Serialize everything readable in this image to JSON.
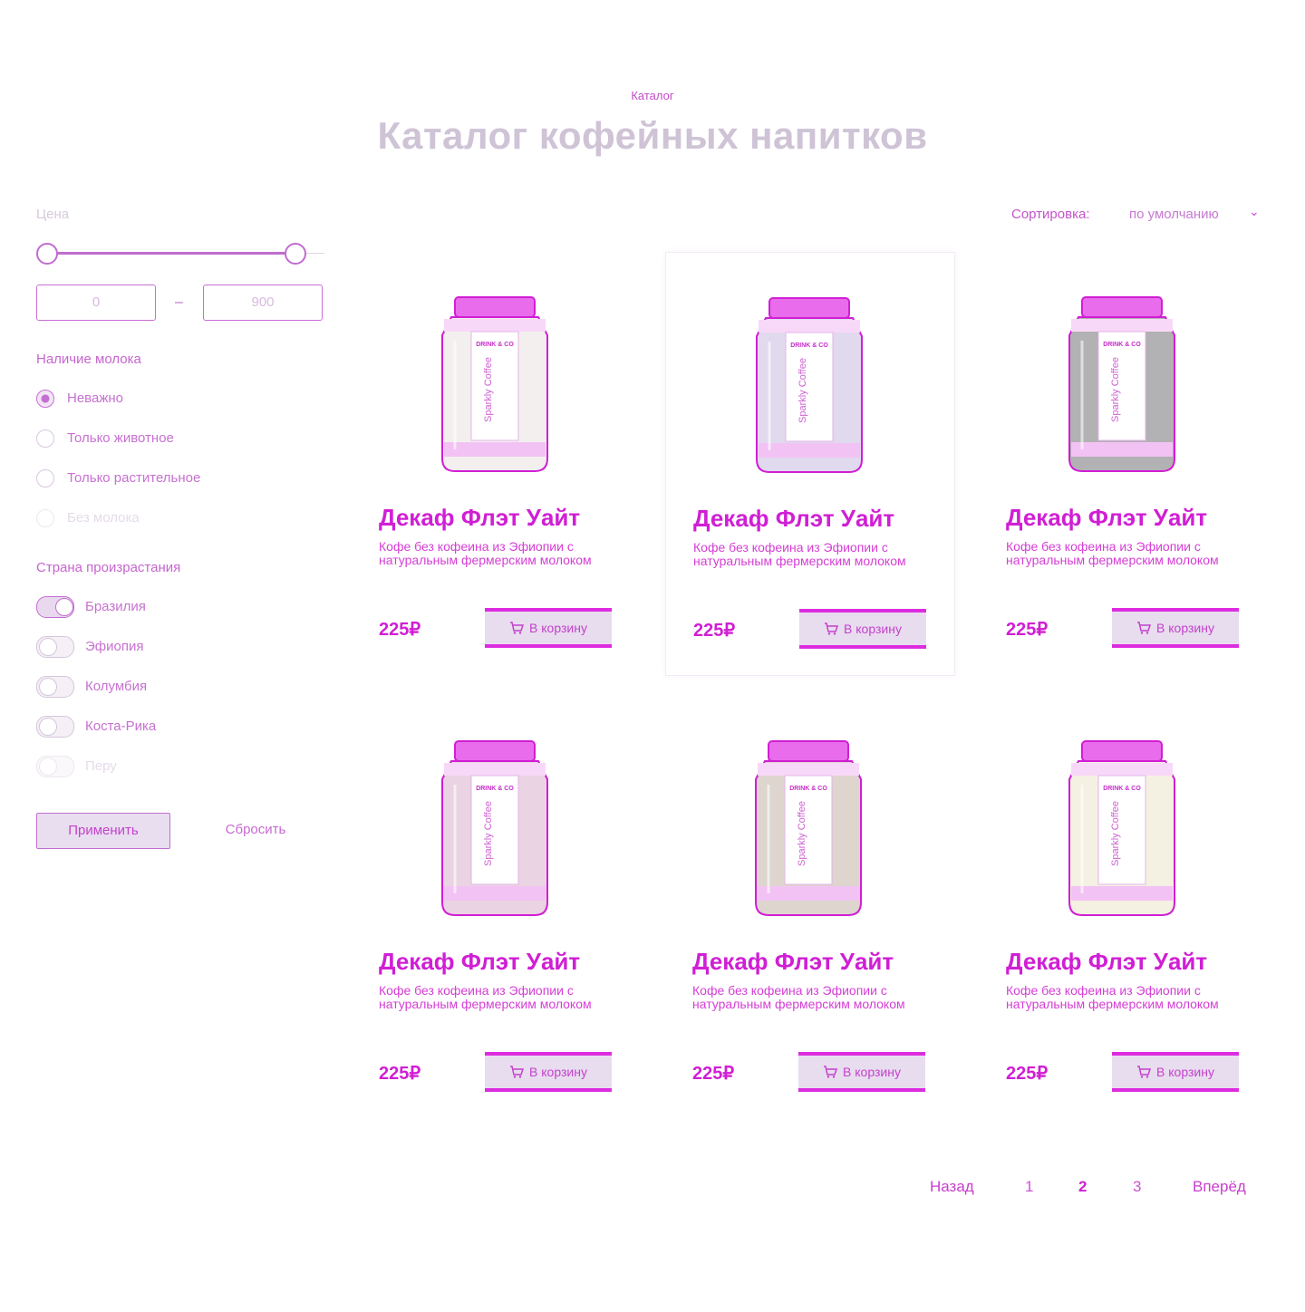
{
  "breadcrumb": "Каталог",
  "page_title": "Каталог кофейных напитков",
  "filters": {
    "price_label": "Цена",
    "price_min": "0",
    "price_max": "900",
    "price_separator": "–",
    "milk_label": "Наличие молока",
    "milk_options": [
      {
        "label": "Неважно",
        "selected": true
      },
      {
        "label": "Только животное",
        "selected": false
      },
      {
        "label": "Только растительное",
        "selected": false
      },
      {
        "label": "Без молока",
        "selected": false
      }
    ],
    "country_label": "Страна произрастания",
    "country_options": [
      {
        "label": "Бразилия",
        "on": true
      },
      {
        "label": "Эфиопия",
        "on": false
      },
      {
        "label": "Колумбия",
        "on": false
      },
      {
        "label": "Коста-Рика",
        "on": false
      },
      {
        "label": "Перу",
        "on": false
      }
    ],
    "apply_label": "Применить",
    "reset_label": "Сбросить"
  },
  "sort": {
    "label": "Сортировка:",
    "value": "по умолчанию"
  },
  "products": [
    {
      "title": "Декаф Флэт Уайт",
      "description": "Кофе без кофеина из Эфиопии с натуральным фермерским молоком",
      "price": "225₽",
      "cart_label": "В корзину",
      "jar_color": "#f2efee",
      "jar_brand": "DRINK & CO",
      "jar_side_text": "Sparkly Coffee"
    },
    {
      "title": "Декаф Флэт Уайт",
      "description": "Кофе без кофеина из Эфиопии с натуральным фермерским молоком",
      "price": "225₽",
      "cart_label": "В корзину",
      "jar_color": "#e1d9ee",
      "jar_brand": "DRINK & CO",
      "jar_side_text": "Sparkly Coffee"
    },
    {
      "title": "Декаф Флэт Уайт",
      "description": "Кофе без кофеина из Эфиопии с натуральным фермерским молоком",
      "price": "225₽",
      "cart_label": "В корзину",
      "jar_color": "#b2b1b3",
      "jar_brand": "DRINK & CO",
      "jar_side_text": "Sparkly Coffee"
    },
    {
      "title": "Декаф Флэт Уайт",
      "description": "Кофе без кофеина из Эфиопии с натуральным фермерским молоком",
      "price": "225₽",
      "cart_label": "В корзину",
      "jar_color": "#ead3e2",
      "jar_brand": "DRINK & CO",
      "jar_side_text": "Sparkly Coffee"
    },
    {
      "title": "Декаф Флэт Уайт",
      "description": "Кофе без кофеина из Эфиопии с натуральным фермерским молоком",
      "price": "225₽",
      "cart_label": "В корзину",
      "jar_color": "#ddd5ce",
      "jar_brand": "DRINK & CO",
      "jar_side_text": "Sparkly Coffee"
    },
    {
      "title": "Декаф Флэт Уайт",
      "description": "Кофе без кофеина из Эфиопии с натуральным фермерским молоком",
      "price": "225₽",
      "cart_label": "В корзину",
      "jar_color": "#f4f0e2",
      "jar_brand": "DRINK & CO",
      "jar_side_text": "Sparkly Coffee"
    }
  ],
  "pagination": {
    "prev": "Назад",
    "pages": [
      "1",
      "2",
      "3"
    ],
    "current": "2",
    "next": "Вперёд"
  },
  "colors": {
    "accent": "#d91ed9",
    "button_fill": "#e8dcef"
  }
}
